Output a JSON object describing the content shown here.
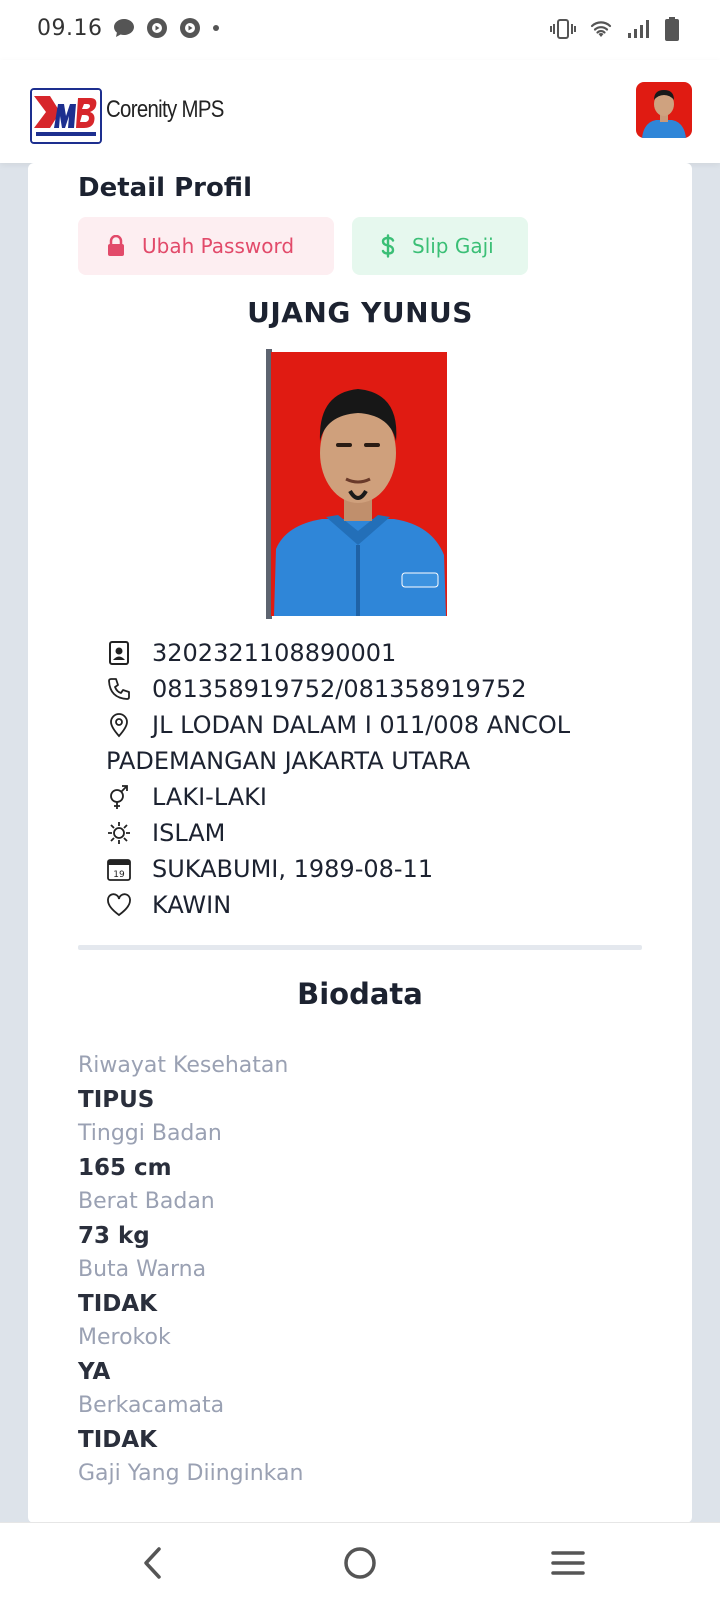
{
  "status_bar": {
    "time": "09.16",
    "left_icons": [
      "chat-bubble-icon",
      "media-app-icon",
      "media-app-icon-2",
      "dot-icon"
    ],
    "right_icons": [
      "vibrate-icon",
      "wifi-icon",
      "signal-icon",
      "battery-icon"
    ]
  },
  "header": {
    "app_title": "Corenity MPS",
    "logo_text": "MB"
  },
  "profile": {
    "section_title": "Detail Profil",
    "buttons": {
      "password_label": "Ubah Password",
      "slip_label": "Slip Gaji"
    },
    "name": "UJANG YUNUS",
    "id_number": "3202321108890001",
    "phone": "081358919752/081358919752",
    "address": "JL LODAN DALAM I 011/008 ANCOL PADEMANGAN JAKARTA UTARA",
    "gender": "LAKI-LAKI",
    "religion": "ISLAM",
    "birth": "SUKABUMI, 1989-08-11",
    "marital_status": "KAWIN",
    "calendar_day": "19"
  },
  "biodata": {
    "title": "Biodata",
    "items": [
      {
        "label": "Riwayat Kesehatan",
        "value": "TIPUS"
      },
      {
        "label": "Tinggi Badan",
        "value": "165 cm"
      },
      {
        "label": "Berat Badan",
        "value": "73 kg"
      },
      {
        "label": "Buta Warna",
        "value": "TIDAK"
      },
      {
        "label": "Merokok",
        "value": "YA"
      },
      {
        "label": "Berkacamata",
        "value": "TIDAK"
      },
      {
        "label": "Gaji Yang Diinginkan",
        "value": ""
      }
    ]
  },
  "colors": {
    "accent_red": "#e24a6a",
    "accent_green": "#3bbf76",
    "photo_background": "#e01b12",
    "shirt_blue": "#2f86d8"
  },
  "nav": [
    "back-icon",
    "home-icon",
    "menu-icon"
  ]
}
